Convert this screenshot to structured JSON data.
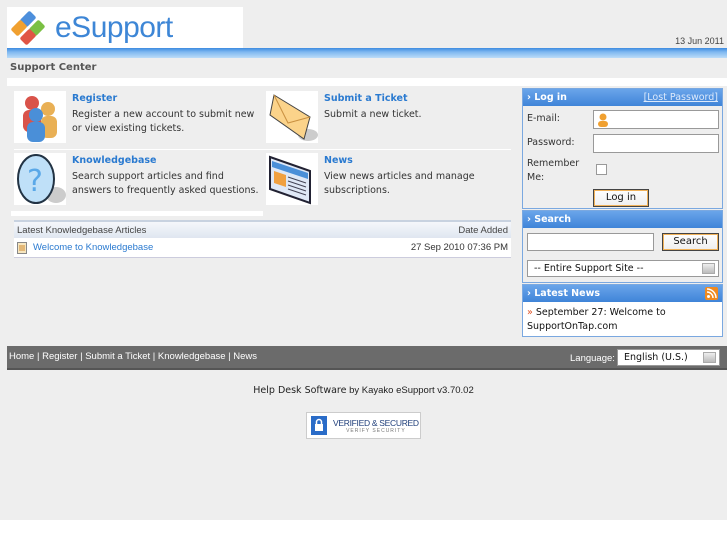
{
  "header": {
    "logo_text": "eSupport",
    "date": "13 Jun 2011",
    "section_title": "Support Center"
  },
  "tiles": [
    {
      "title": "Register",
      "desc": "Register a new account to submit new or view existing tickets."
    },
    {
      "title": "Submit a Ticket",
      "desc": "Submit a new ticket."
    },
    {
      "title": "Knowledgebase",
      "desc": "Search support articles and find answers to frequently asked questions."
    },
    {
      "title": "News",
      "desc": "View news articles and manage subscriptions."
    }
  ],
  "kb": {
    "header": "Latest Knowledgebase Articles",
    "date_header": "Date Added",
    "rows": [
      {
        "title": "Welcome to Knowledgebase",
        "date": "27 Sep 2010 07:36 PM"
      }
    ]
  },
  "login": {
    "title": "Log in",
    "lost_password": "[Lost Password]",
    "email_label": "E-mail:",
    "password_label": "Password:",
    "remember_label": "Remember Me:",
    "button": "Log in"
  },
  "search": {
    "title": "Search",
    "button": "Search",
    "scope": "-- Entire Support Site --"
  },
  "news": {
    "title": "Latest News",
    "item": "September 27: Welcome to SupportOnTap.com"
  },
  "footer": {
    "links": [
      "Home",
      "Register",
      "Submit a Ticket",
      "Knowledgebase",
      "News"
    ],
    "language_label": "Language:",
    "language": "English (U.S.)"
  },
  "credit": {
    "bold": "Help Desk Software",
    "rest": " by Kayako eSupport v3.70.02"
  },
  "badge": {
    "line1": "VERIFIED & SECURED",
    "line2": "VERIFY SECURITY"
  }
}
